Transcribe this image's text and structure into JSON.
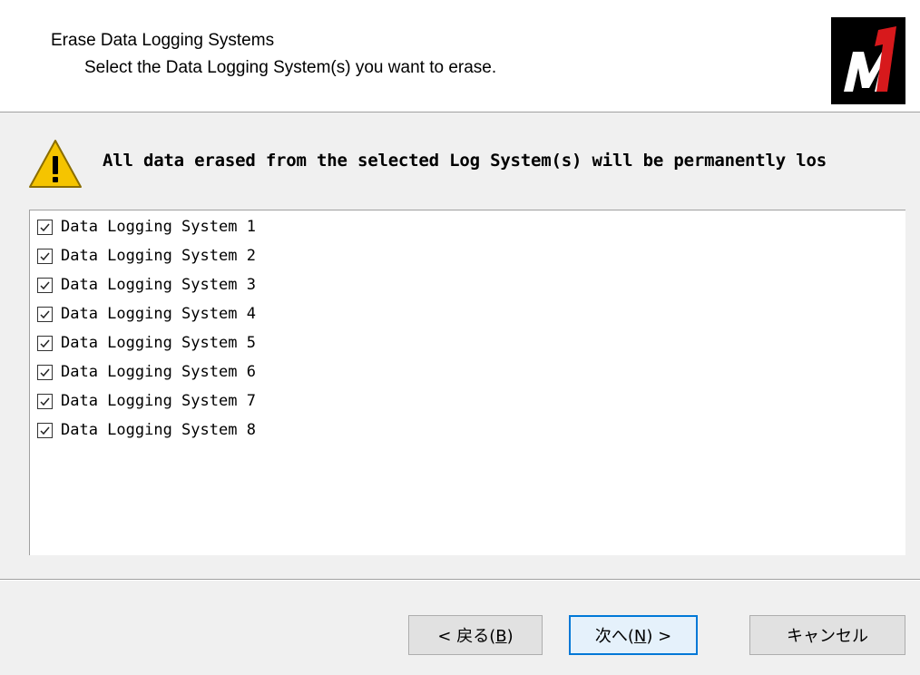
{
  "header": {
    "title": "Erase Data Logging Systems",
    "subtitle": "Select the Data Logging System(s) you want to erase.",
    "logo_text": "M1",
    "logo_colors": {
      "background": "#000000",
      "letter": "#ffffff",
      "digit": "#d7191c"
    }
  },
  "warning": {
    "icon": "warning-triangle-icon",
    "text": "All data erased from the selected Log System(s) will be permanently los"
  },
  "systems": [
    {
      "label": "Data Logging System 1",
      "checked": true
    },
    {
      "label": "Data Logging System 2",
      "checked": true
    },
    {
      "label": "Data Logging System 3",
      "checked": true
    },
    {
      "label": "Data Logging System 4",
      "checked": true
    },
    {
      "label": "Data Logging System 5",
      "checked": true
    },
    {
      "label": "Data Logging System 6",
      "checked": true
    },
    {
      "label": "Data Logging System 7",
      "checked": true
    },
    {
      "label": "Data Logging System 8",
      "checked": true
    }
  ],
  "buttons": {
    "back": {
      "prefix": "< 戻る(",
      "mnemonic": "B",
      "suffix": ")"
    },
    "next": {
      "prefix": "次へ(",
      "mnemonic": "N",
      "suffix": ") >"
    },
    "cancel": {
      "label": "キャンセル"
    }
  },
  "colors": {
    "accent": "#0078d7",
    "warning": "#f5c400"
  }
}
